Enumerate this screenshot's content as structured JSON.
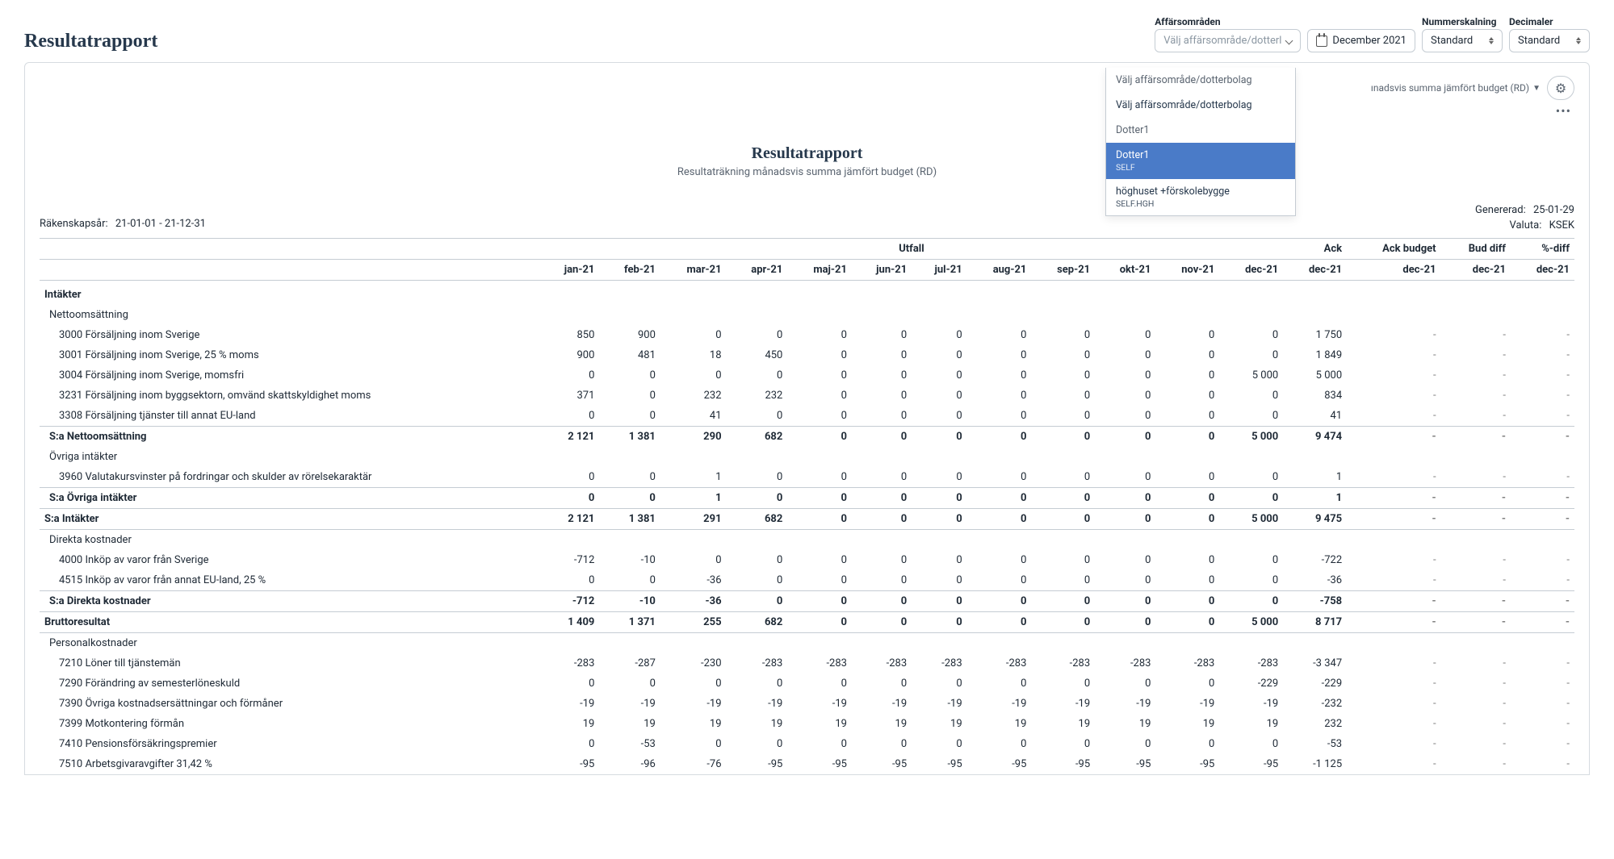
{
  "page_title": "Resultatrapport",
  "top": {
    "areas_label": "Affärsområden",
    "areas_placeholder": "Välj affärsområde/dotterl",
    "period_value": "December 2021",
    "scaling_label": "Nummerskalning",
    "scaling_value": "Standard",
    "decimals_label": "Decimaler",
    "decimals_value": "Standard"
  },
  "dropdown": {
    "header": "Välj affärsområde/dotterbolag",
    "choose": "Välj affärsområde/dotterbolag",
    "group": "Dotter1",
    "items": [
      {
        "name": "Dotter1",
        "sub": "SELF",
        "active": true
      },
      {
        "name": "höghuset +förskolebygge",
        "sub": "SELF.HGH",
        "active": false
      }
    ]
  },
  "sheet_view": "ınadsvis summa jämfört budget (RD)",
  "report": {
    "title": "Resultatrapport",
    "subtitle": "Resultaträkning månadsvis summa jämfört budget (RD)"
  },
  "meta": {
    "period_label": "Räkenskapsår:",
    "period_value": "21-01-01 - 21-12-31",
    "generated_label": "Genererad:",
    "generated_value": "25-01-29",
    "currency_label": "Valuta:",
    "currency_value": "KSEK"
  },
  "col_groups": {
    "utfall": "Utfall",
    "ack": "Ack",
    "ack_budget": "Ack budget",
    "bud_diff": "Bud diff",
    "pct_diff": "%-diff"
  },
  "months": [
    "jan-21",
    "feb-21",
    "mar-21",
    "apr-21",
    "maj-21",
    "jun-21",
    "jul-21",
    "aug-21",
    "sep-21",
    "okt-21",
    "nov-21",
    "dec-21",
    "dec-21",
    "dec-21",
    "dec-21",
    "dec-21"
  ],
  "sections": {
    "intakter": "Intäkter",
    "nettooms": "Nettoomsättning",
    "ovriga": "Övriga intäkter",
    "direkta": "Direkta kostnader",
    "personal": "Personalkostnader"
  },
  "rows": {
    "r3000": {
      "label": "3000 Försäljning inom Sverige",
      "v": [
        "850",
        "900",
        "0",
        "0",
        "0",
        "0",
        "0",
        "0",
        "0",
        "0",
        "0",
        "0",
        "1 750"
      ]
    },
    "r3001": {
      "label": "3001 Försäljning inom Sverige, 25 % moms",
      "v": [
        "900",
        "481",
        "18",
        "450",
        "0",
        "0",
        "0",
        "0",
        "0",
        "0",
        "0",
        "0",
        "1 849"
      ]
    },
    "r3004": {
      "label": "3004 Försäljning inom Sverige, momsfri",
      "v": [
        "0",
        "0",
        "0",
        "0",
        "0",
        "0",
        "0",
        "0",
        "0",
        "0",
        "0",
        "5 000",
        "5 000"
      ]
    },
    "r3231": {
      "label": "3231 Försäljning inom byggsektorn, omvänd skattskyldighet moms",
      "v": [
        "371",
        "0",
        "232",
        "232",
        "0",
        "0",
        "0",
        "0",
        "0",
        "0",
        "0",
        "0",
        "834"
      ]
    },
    "r3308": {
      "label": "3308 Försäljning tjänster till annat EU-land",
      "v": [
        "0",
        "0",
        "41",
        "0",
        "0",
        "0",
        "0",
        "0",
        "0",
        "0",
        "0",
        "0",
        "41"
      ]
    },
    "s_netto": {
      "label": "S:a Nettoomsättning",
      "v": [
        "2 121",
        "1 381",
        "290",
        "682",
        "0",
        "0",
        "0",
        "0",
        "0",
        "0",
        "0",
        "5 000",
        "9 474"
      ]
    },
    "r3960": {
      "label": "3960 Valutakursvinster på fordringar och skulder av rörelsekaraktär",
      "v": [
        "0",
        "0",
        "1",
        "0",
        "0",
        "0",
        "0",
        "0",
        "0",
        "0",
        "0",
        "0",
        "1"
      ]
    },
    "s_ovriga": {
      "label": "S:a Övriga intäkter",
      "v": [
        "0",
        "0",
        "1",
        "0",
        "0",
        "0",
        "0",
        "0",
        "0",
        "0",
        "0",
        "0",
        "1"
      ]
    },
    "s_intakter": {
      "label": "S:a Intäkter",
      "v": [
        "2 121",
        "1 381",
        "291",
        "682",
        "0",
        "0",
        "0",
        "0",
        "0",
        "0",
        "0",
        "5 000",
        "9 475"
      ]
    },
    "r4000": {
      "label": "4000 Inköp av varor från Sverige",
      "v": [
        "-712",
        "-10",
        "0",
        "0",
        "0",
        "0",
        "0",
        "0",
        "0",
        "0",
        "0",
        "0",
        "-722"
      ]
    },
    "r4515": {
      "label": "4515 Inköp av varor från annat EU-land, 25 %",
      "v": [
        "0",
        "0",
        "-36",
        "0",
        "0",
        "0",
        "0",
        "0",
        "0",
        "0",
        "0",
        "0",
        "-36"
      ]
    },
    "s_direkta": {
      "label": "S:a Direkta kostnader",
      "v": [
        "-712",
        "-10",
        "-36",
        "0",
        "0",
        "0",
        "0",
        "0",
        "0",
        "0",
        "0",
        "0",
        "-758"
      ]
    },
    "brutto": {
      "label": "Bruttoresultat",
      "v": [
        "1 409",
        "1 371",
        "255",
        "682",
        "0",
        "0",
        "0",
        "0",
        "0",
        "0",
        "0",
        "5 000",
        "8 717"
      ]
    },
    "r7210": {
      "label": "7210 Löner till tjänstemän",
      "v": [
        "-283",
        "-287",
        "-230",
        "-283",
        "-283",
        "-283",
        "-283",
        "-283",
        "-283",
        "-283",
        "-283",
        "-283",
        "-3 347"
      ]
    },
    "r7290": {
      "label": "7290 Förändring av semesterlöneskuld",
      "v": [
        "0",
        "0",
        "0",
        "0",
        "0",
        "0",
        "0",
        "0",
        "0",
        "0",
        "0",
        "-229",
        "-229"
      ]
    },
    "r7390": {
      "label": "7390 Övriga kostnadsersättningar och förmåner",
      "v": [
        "-19",
        "-19",
        "-19",
        "-19",
        "-19",
        "-19",
        "-19",
        "-19",
        "-19",
        "-19",
        "-19",
        "-19",
        "-232"
      ]
    },
    "r7399": {
      "label": "7399 Motkontering förmån",
      "v": [
        "19",
        "19",
        "19",
        "19",
        "19",
        "19",
        "19",
        "19",
        "19",
        "19",
        "19",
        "19",
        "232"
      ]
    },
    "r7410": {
      "label": "7410 Pensionsförsäkringspremier",
      "v": [
        "0",
        "-53",
        "0",
        "0",
        "0",
        "0",
        "0",
        "0",
        "0",
        "0",
        "0",
        "0",
        "-53"
      ]
    },
    "r7510": {
      "label": "7510 Arbetsgivaravgifter 31,42 %",
      "v": [
        "-95",
        "-96",
        "-76",
        "-95",
        "-95",
        "-95",
        "-95",
        "-95",
        "-95",
        "-95",
        "-95",
        "-95",
        "-1 125"
      ]
    }
  }
}
